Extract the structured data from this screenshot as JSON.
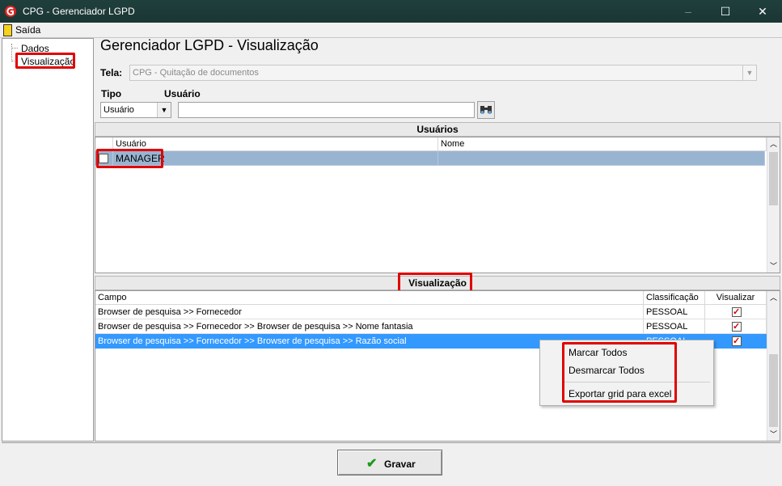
{
  "window": {
    "title": "CPG - Gerenciador LGPD",
    "minimize": "–",
    "maximize": "☐",
    "close": "✕"
  },
  "menubar": {
    "exit_label": "Saída"
  },
  "tree": {
    "items": [
      {
        "label": "Dados"
      },
      {
        "label": "Visualização"
      }
    ]
  },
  "main": {
    "heading": "Gerenciador LGPD - Visualização",
    "tela_label": "Tela:",
    "tela_value": "CPG - Quitação de documentos",
    "tipo_label": "Tipo",
    "usuario_label": "Usuário",
    "tipo_value": "Usuário",
    "usuario_value": ""
  },
  "usuarios": {
    "header": "Usuários",
    "columns": [
      "Usuário",
      "Nome"
    ],
    "rows": [
      {
        "usuario": "MANAGER",
        "nome": "",
        "checked": false
      }
    ]
  },
  "visualizacao": {
    "header": "Visualização",
    "columns": [
      "Campo",
      "Classificação",
      "Visualizar"
    ],
    "rows": [
      {
        "campo": "Browser de pesquisa >> Fornecedor",
        "classificacao": "PESSOAL",
        "visualizar": true
      },
      {
        "campo": "Browser de pesquisa >> Fornecedor >> Browser de pesquisa >>  Nome fantasia",
        "classificacao": "PESSOAL",
        "visualizar": true
      },
      {
        "campo": "Browser de pesquisa >> Fornecedor >> Browser de pesquisa >>  Razão social",
        "classificacao": "PESSOAL",
        "visualizar": true
      }
    ]
  },
  "context_menu": {
    "items": [
      "Marcar Todos",
      "Desmarcar Todos",
      "Exportar grid para excel"
    ]
  },
  "footer": {
    "save_label": "Gravar"
  },
  "colors": {
    "titlebar": "#1f3f3d",
    "selection": "#3399ff",
    "highlight_row": "#99b4d1",
    "annotation": "#e00000"
  }
}
